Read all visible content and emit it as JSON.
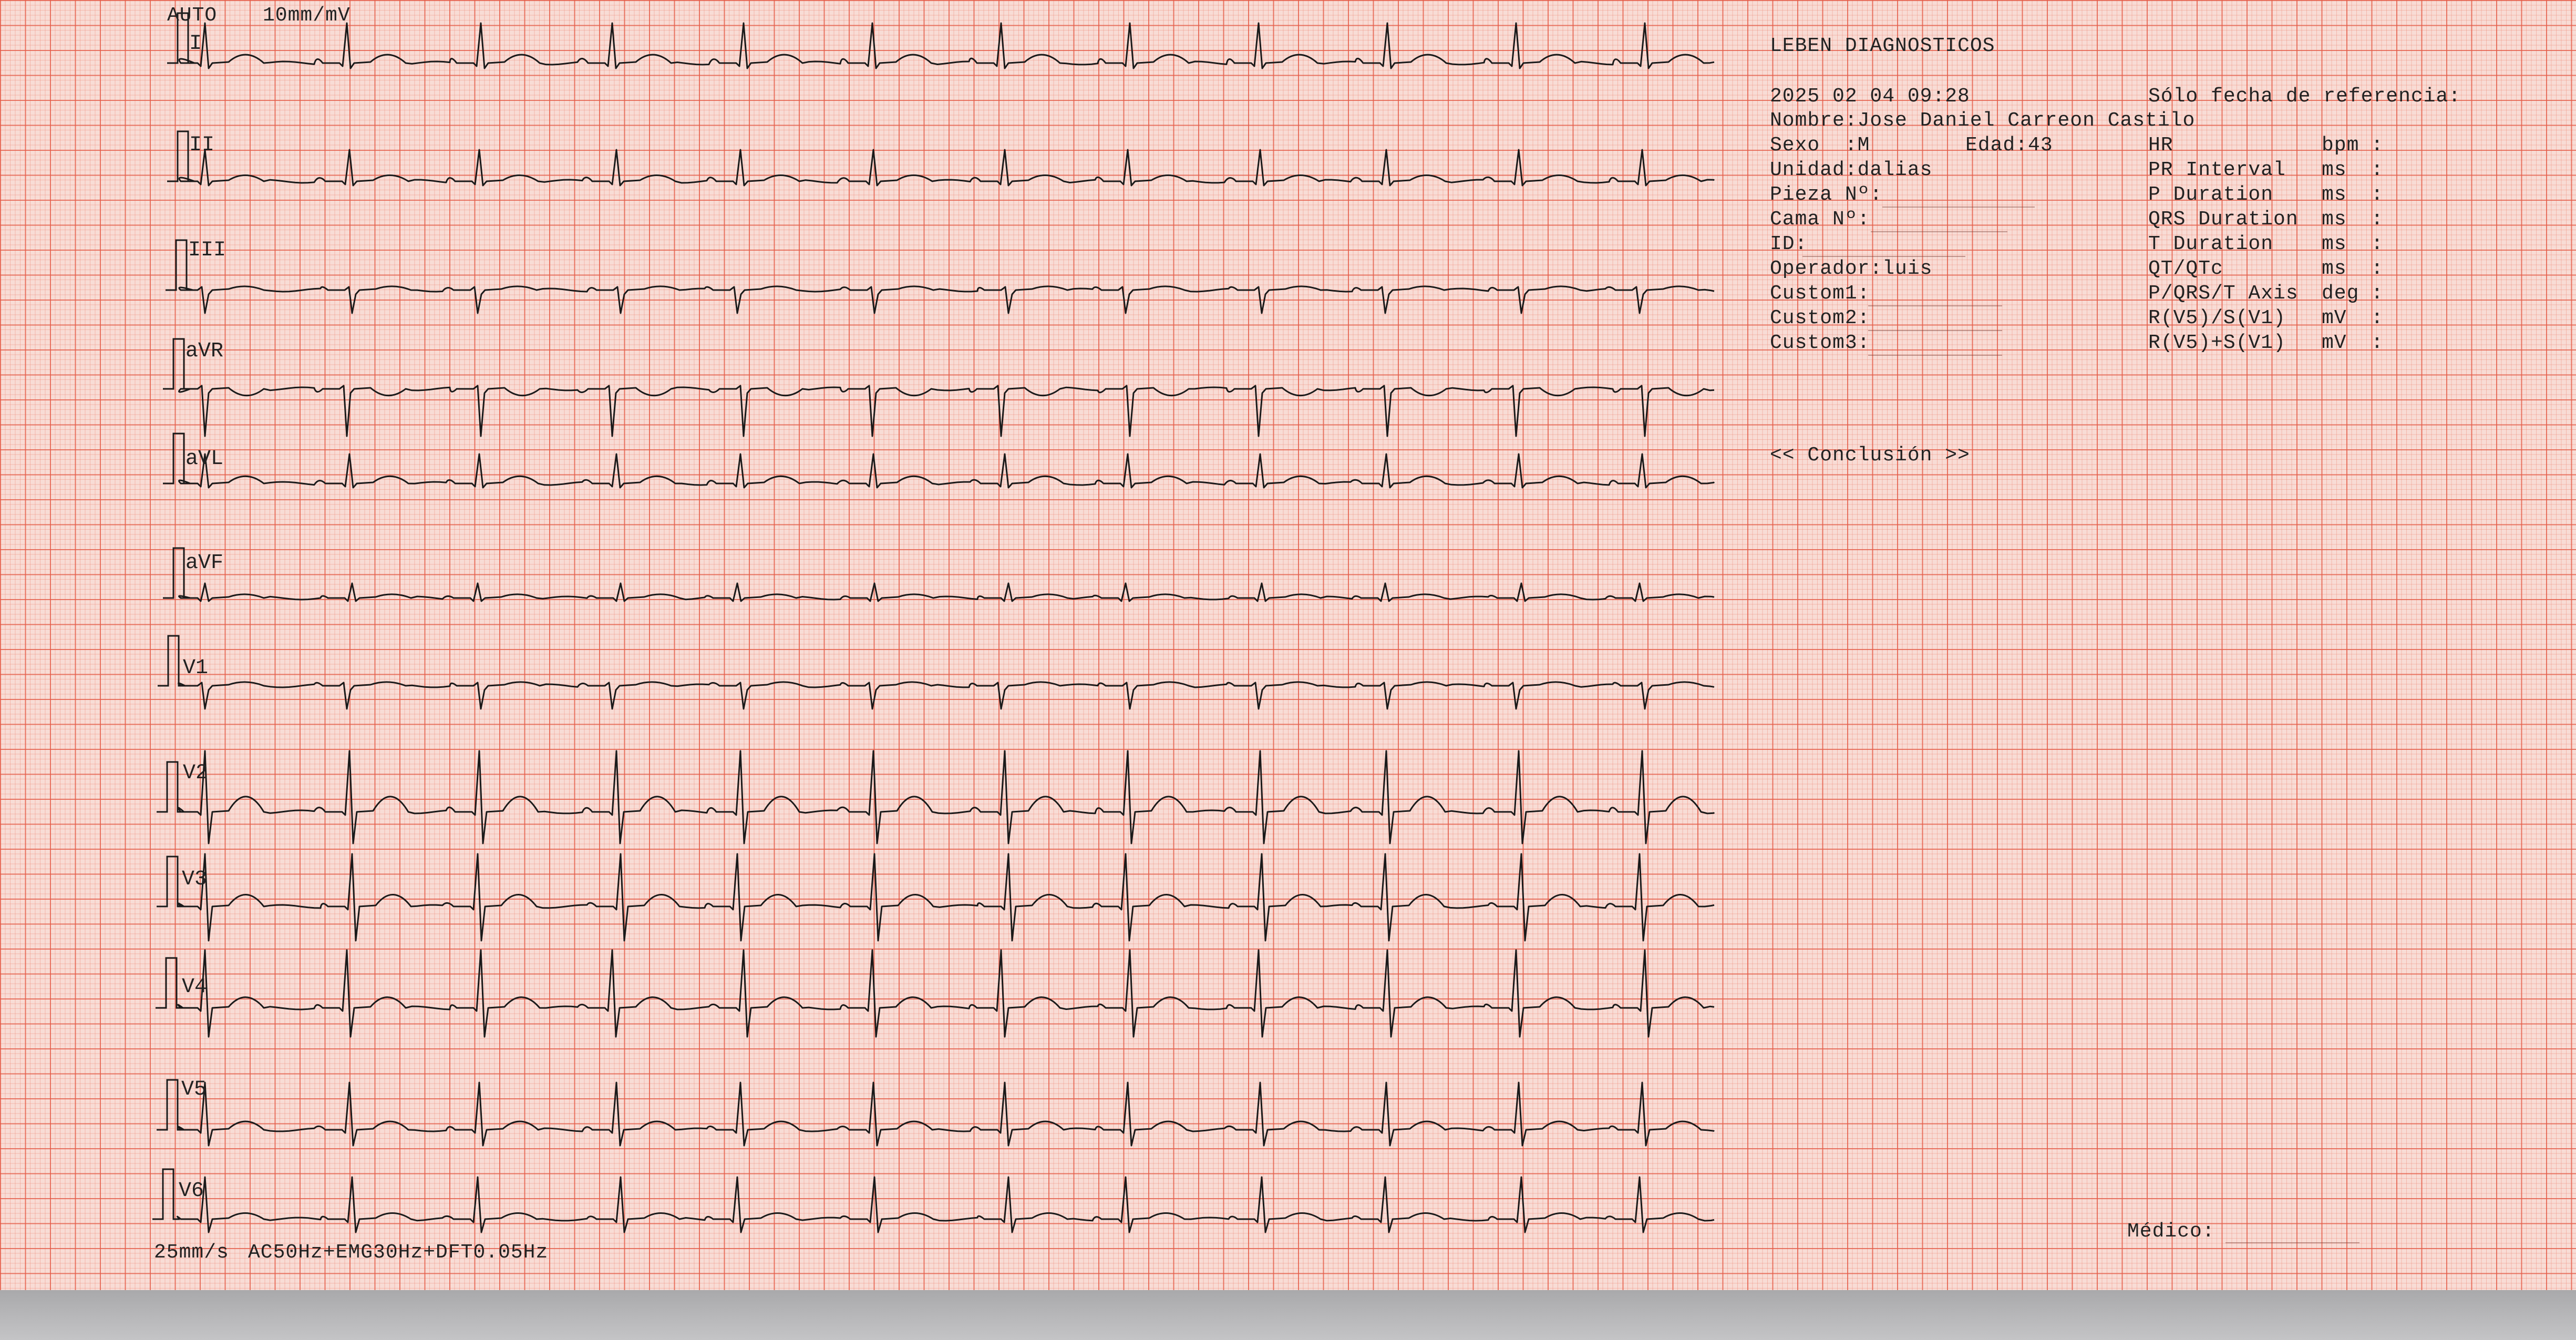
{
  "header": {
    "mode": "AUTO",
    "gain": "10mm/mV"
  },
  "footer": {
    "speed": "25mm/s",
    "filters": "AC50Hz+EMG30Hz+DFT0.05Hz"
  },
  "leads": [
    "I",
    "II",
    "III",
    "aVR",
    "aVL",
    "aVF",
    "V1",
    "V2",
    "V3",
    "V4",
    "V5",
    "V6"
  ],
  "patient": {
    "clinic": "LEBEN DIAGNOSTICOS",
    "datetime": "2025 02 04 09:28",
    "reference_note": "Sólo fecha de referencia:",
    "name_line": "Nombre:Jose Daniel Carreon Castilo",
    "sex_line": "Sexo  :M",
    "age_line": "Edad:43",
    "unit_line": "Unidad:dalias",
    "room_line": "Pieza Nº:",
    "bed_line": "Cama Nº:",
    "id_line": "ID:",
    "operator_line": "Operador:luis",
    "custom1_line": "Custom1:",
    "custom2_line": "Custom2:",
    "custom3_line": "Custom3:"
  },
  "measurements": [
    {
      "name": "HR",
      "unit": "bpm",
      "sep": ":"
    },
    {
      "name": "PR Interval",
      "unit": "ms",
      "sep": ":"
    },
    {
      "name": "P Duration",
      "unit": "ms",
      "sep": ":"
    },
    {
      "name": "QRS Duration",
      "unit": "ms",
      "sep": ":"
    },
    {
      "name": "T Duration",
      "unit": "ms",
      "sep": ":"
    },
    {
      "name": "QT/QTc",
      "unit": "ms",
      "sep": ":"
    },
    {
      "name": "P/QRS/T Axis",
      "unit": "deg",
      "sep": ":"
    },
    {
      "name": "R(V5)/S(V1)",
      "unit": "mV",
      "sep": ":"
    },
    {
      "name": "R(V5)+S(V1)",
      "unit": "mV",
      "sep": ":"
    }
  ],
  "conclusion_label": "<< Conclusión >>",
  "doctor_label": "Médico:",
  "colors": {
    "paper": "#f8dcd5",
    "grid": "#e45c48",
    "trace": "#1a1a1a",
    "text": "#222222"
  }
}
